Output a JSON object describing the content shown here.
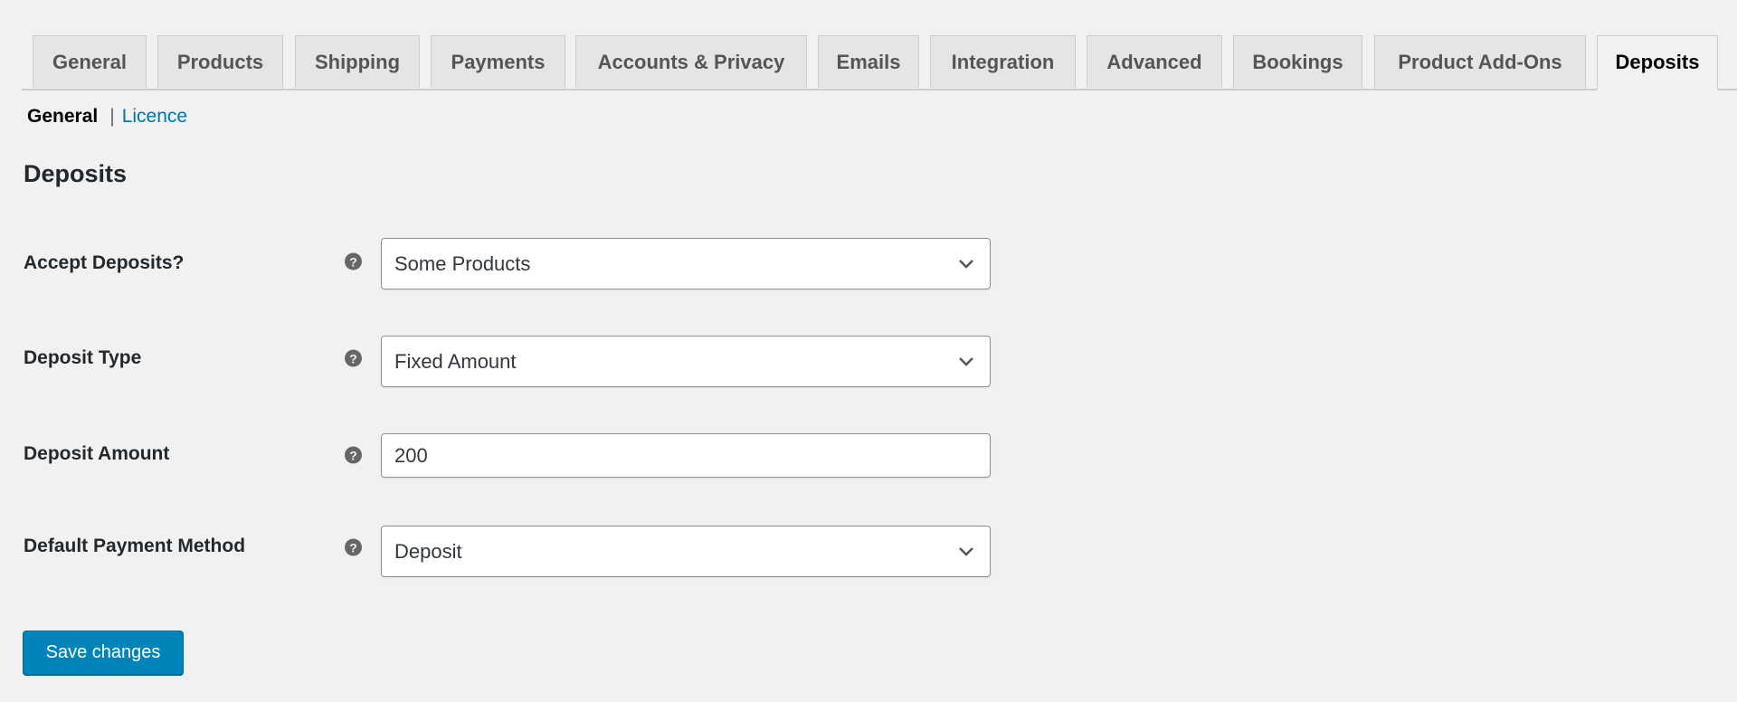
{
  "tabs": [
    {
      "label": "General",
      "active": false
    },
    {
      "label": "Products",
      "active": false
    },
    {
      "label": "Shipping",
      "active": false
    },
    {
      "label": "Payments",
      "active": false
    },
    {
      "label": "Accounts & Privacy",
      "active": false
    },
    {
      "label": "Emails",
      "active": false
    },
    {
      "label": "Integration",
      "active": false
    },
    {
      "label": "Advanced",
      "active": false
    },
    {
      "label": "Bookings",
      "active": false
    },
    {
      "label": "Product Add-Ons",
      "active": false
    },
    {
      "label": "Deposits",
      "active": true
    }
  ],
  "subnav": {
    "current": "General",
    "separator": "|",
    "link": "Licence"
  },
  "section_title": "Deposits",
  "form": {
    "rows": [
      {
        "label": "Accept Deposits?",
        "type": "select",
        "value": "Some Products",
        "help_icon": "question-circle-icon"
      },
      {
        "label": "Deposit Type",
        "type": "select",
        "value": "Fixed Amount",
        "help_icon": "question-circle-icon"
      },
      {
        "label": "Deposit Amount",
        "type": "text",
        "value": "200",
        "help_icon": "question-circle-icon"
      },
      {
        "label": "Default Payment Method",
        "type": "select",
        "value": "Deposit",
        "help_icon": "question-circle-icon"
      }
    ],
    "help_glyph": "?"
  },
  "save_button": {
    "label": "Save changes"
  },
  "colors": {
    "primary_button": "#0085ba",
    "link": "#0073aa",
    "background": "#f1f1f1",
    "tab_inactive": "#e5e5e5"
  }
}
